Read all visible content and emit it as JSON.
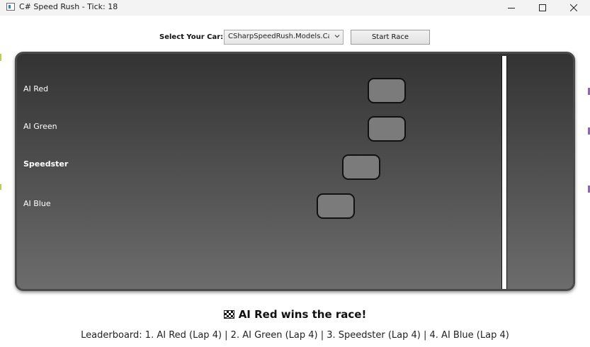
{
  "window": {
    "title": "C# Speed Rush - Tick: 18",
    "icon": "app-window-icon",
    "controls": [
      "minimize-icon",
      "maximize-icon",
      "close-icon"
    ]
  },
  "controls": {
    "select_label": "Select Your Car:",
    "car_select_value": "CSharpSpeedRush.Models.Car",
    "start_button_label": "Start Race"
  },
  "track": {
    "lanes": [
      {
        "label": "AI Red",
        "bold": false,
        "color": "#7b7b7b"
      },
      {
        "label": "AI Green",
        "bold": false,
        "color": "#7b7b7b"
      },
      {
        "label": "Speedster",
        "bold": true,
        "color": "#7b7b7b"
      },
      {
        "label": "AI Blue",
        "bold": false,
        "color": "#7b7b7b"
      }
    ]
  },
  "status": {
    "winner_icon": "checkered-flag-icon",
    "winner_text": "AI Red wins the race!",
    "leaderboard": "Leaderboard: 1. AI Red (Lap 4) | 2. AI Green (Lap 4) | 3. Speedster (Lap 4) | 4. AI Blue (Lap 4)"
  },
  "colors": {
    "track_top": "#333333",
    "track_bottom": "#6c6c6c",
    "finish_line": "#ffffff",
    "car_fill": "#7b7b7b"
  }
}
